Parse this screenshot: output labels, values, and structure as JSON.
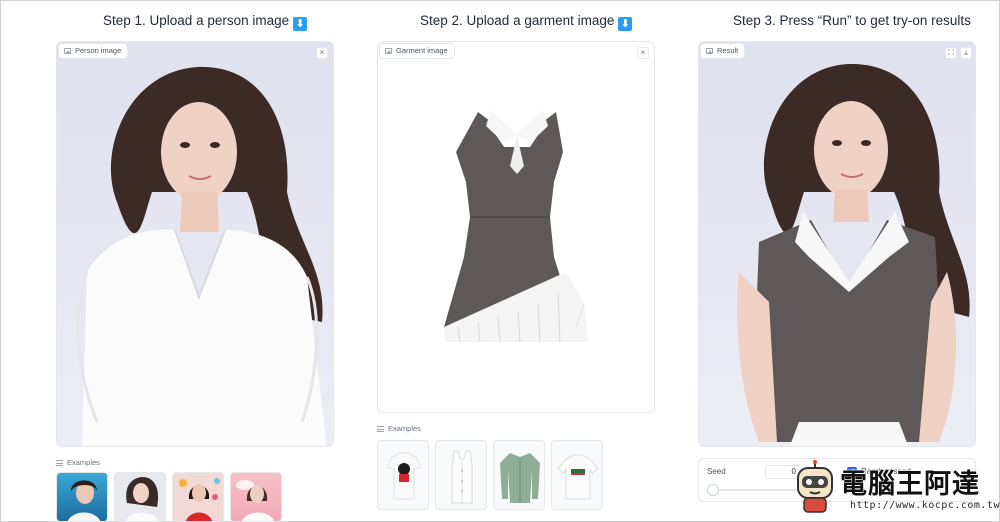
{
  "steps": {
    "step1": "Step 1. Upload a person image",
    "step2": "Step 2. Upload a garment image",
    "step3": "Step 3. Press “Run” to get try-on results",
    "arrow_glyph": "⬇"
  },
  "person_panel": {
    "label": "Person image",
    "close": "×"
  },
  "garment_panel": {
    "label": "Garment image",
    "close": "×"
  },
  "result_panel": {
    "label": "Result",
    "fullscreen": "⛶",
    "download": "⤓"
  },
  "person_examples": {
    "label": "Examples"
  },
  "garment_examples": {
    "label": "Examples"
  },
  "seed": {
    "label": "Seed",
    "value": "0",
    "slider_value": 0,
    "randomize_label": "Random seed",
    "randomize_checked": true
  },
  "watermark": {
    "text": "電腦王阿達",
    "url": "http://www.kocpc.com.tw"
  },
  "colors": {
    "accent": "#2a9df4",
    "checkbox": "#2563eb",
    "vest": "#5f5858",
    "shirt": "#f7f7f7",
    "backdrop": "#e3e5f0"
  },
  "icons": [
    "image-icon",
    "close-icon",
    "fullscreen-icon",
    "download-icon",
    "list-icon",
    "arrow-down-icon",
    "robot-mascot-icon"
  ]
}
